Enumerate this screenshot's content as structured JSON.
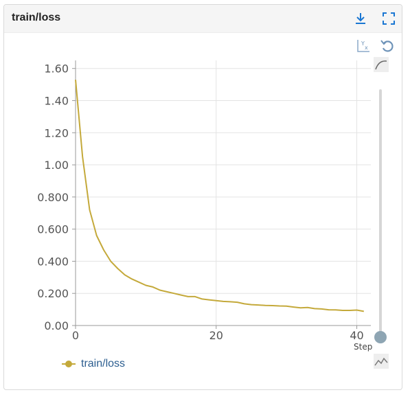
{
  "panel": {
    "title": "train/loss",
    "icons": {
      "download": "download-icon",
      "fullscreen": "fullscreen-icon",
      "fit_domain": "fit-domain-icon",
      "reset": "reset-icon",
      "smoothing": "smoothing-curve-icon",
      "sparkline": "sparkline-icon"
    },
    "accent": "#1976d2"
  },
  "chart_data": {
    "type": "line",
    "xlabel": "Step",
    "xlim": [
      0,
      42
    ],
    "ylim": [
      0.0,
      1.65
    ],
    "xticks": [
      0,
      20,
      40
    ],
    "yticks": [
      0.0,
      0.2,
      0.4,
      0.6,
      0.8,
      1.0,
      1.2,
      1.4,
      1.6
    ],
    "ytick_labels": [
      "0.00",
      "0.200",
      "0.400",
      "0.600",
      "0.800",
      "1.00",
      "1.20",
      "1.40",
      "1.60"
    ],
    "xtick_labels": [
      "0",
      "20",
      "40"
    ],
    "grid": true,
    "legend_position": "bottom-left",
    "series": [
      {
        "name": "train/loss",
        "color": "#c4a93a",
        "x": [
          0,
          1,
          2,
          3,
          4,
          5,
          6,
          7,
          8,
          9,
          10,
          11,
          12,
          13,
          14,
          15,
          16,
          17,
          18,
          19,
          20,
          21,
          22,
          23,
          24,
          25,
          26,
          27,
          28,
          29,
          30,
          31,
          32,
          33,
          34,
          35,
          36,
          37,
          38,
          39,
          40,
          41
        ],
        "y": [
          1.53,
          1.05,
          0.72,
          0.56,
          0.47,
          0.4,
          0.355,
          0.315,
          0.29,
          0.27,
          0.25,
          0.24,
          0.22,
          0.21,
          0.2,
          0.19,
          0.18,
          0.18,
          0.165,
          0.16,
          0.155,
          0.15,
          0.148,
          0.145,
          0.135,
          0.13,
          0.128,
          0.125,
          0.124,
          0.122,
          0.121,
          0.115,
          0.11,
          0.112,
          0.105,
          0.103,
          0.098,
          0.097,
          0.094,
          0.094,
          0.096,
          0.088
        ]
      }
    ]
  },
  "slider": {
    "value": 1.0
  }
}
